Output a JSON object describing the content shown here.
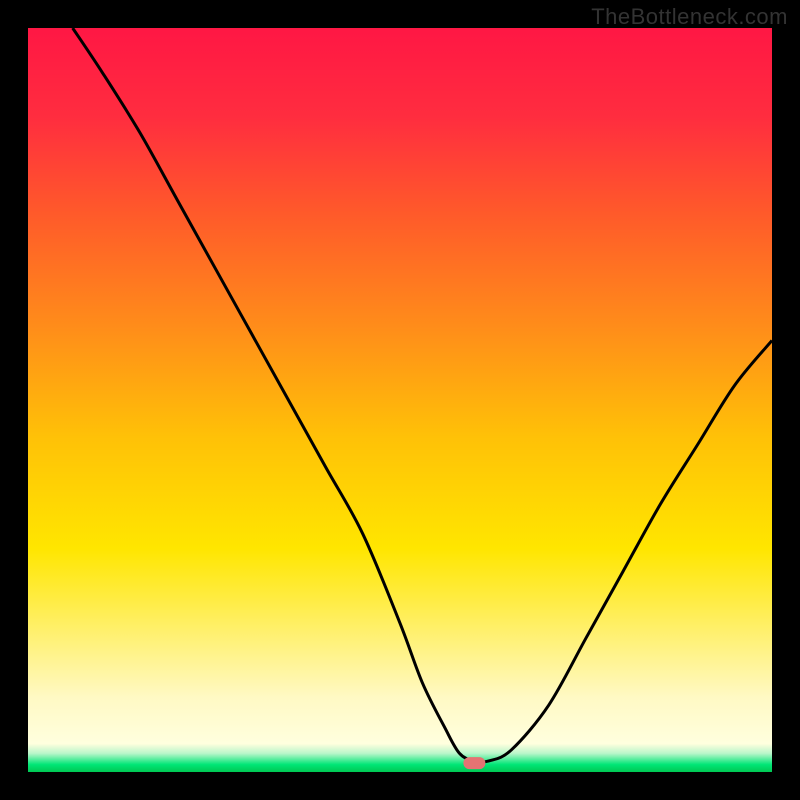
{
  "watermark": "TheBottleneck.com",
  "chart_data": {
    "type": "line",
    "title": "",
    "xlabel": "",
    "ylabel": "",
    "xlim": [
      0,
      100
    ],
    "ylim": [
      0,
      100
    ],
    "grid": false,
    "legend": false,
    "background_gradient": {
      "stops": [
        {
          "offset": 0.0,
          "color": "#ff1744"
        },
        {
          "offset": 0.12,
          "color": "#ff2d3f"
        },
        {
          "offset": 0.25,
          "color": "#ff5a2a"
        },
        {
          "offset": 0.4,
          "color": "#ff8c1a"
        },
        {
          "offset": 0.55,
          "color": "#ffc107"
        },
        {
          "offset": 0.7,
          "color": "#ffe600"
        },
        {
          "offset": 0.82,
          "color": "#fff176"
        },
        {
          "offset": 0.9,
          "color": "#fff9c4"
        },
        {
          "offset": 0.962,
          "color": "#ffffde"
        },
        {
          "offset": 0.975,
          "color": "#b9f6ca"
        },
        {
          "offset": 0.99,
          "color": "#00e676"
        },
        {
          "offset": 1.0,
          "color": "#00c853"
        }
      ]
    },
    "series": [
      {
        "name": "bottleneck-curve",
        "color": "#000000",
        "x": [
          6,
          10,
          15,
          20,
          25,
          30,
          35,
          40,
          45,
          50,
          53,
          56,
          58,
          60,
          62,
          65,
          70,
          75,
          80,
          85,
          90,
          95,
          100
        ],
        "y": [
          100,
          94,
          86,
          77,
          68,
          59,
          50,
          41,
          32,
          20,
          12,
          6,
          2.5,
          1.5,
          1.5,
          3,
          9,
          18,
          27,
          36,
          44,
          52,
          58
        ]
      }
    ],
    "marker": {
      "name": "optimal-point",
      "x": 60,
      "y": 1.2,
      "color": "#e57373",
      "shape": "pill"
    }
  }
}
